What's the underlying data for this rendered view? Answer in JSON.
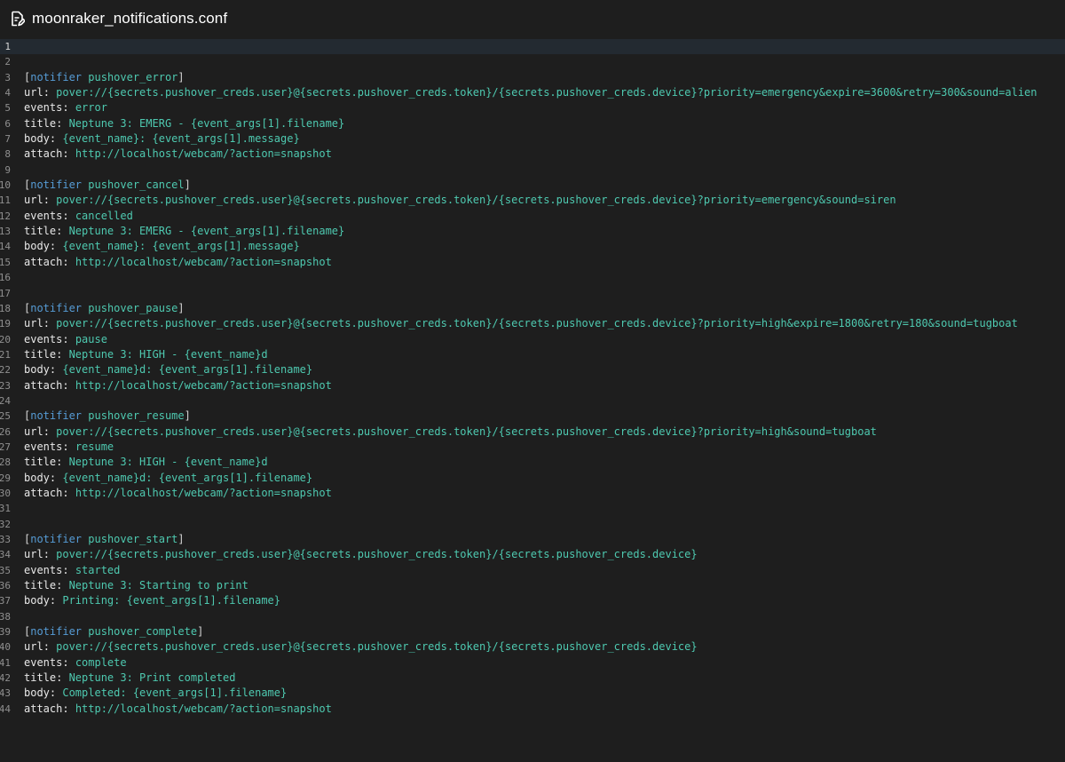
{
  "window": {
    "title": "moonraker_notifications.conf",
    "icon": "file-edit-icon"
  },
  "colors": {
    "background": "#1e1e1e",
    "keyword": "#569cd6",
    "section_name": "#4ec9b0",
    "value": "#4ec9b0",
    "key": "#e8e8e8",
    "line_number": "#8f8f8f"
  },
  "editor": {
    "active_line": 1,
    "lines": [
      {
        "n": "1",
        "kind": "blank"
      },
      {
        "n": "2",
        "kind": "blank"
      },
      {
        "n": "3",
        "kind": "section",
        "keyword": "notifier",
        "name": "pushover_error"
      },
      {
        "n": "4",
        "kind": "kv",
        "key": "url",
        "value": "pover://{secrets.pushover_creds.user}@{secrets.pushover_creds.token}/{secrets.pushover_creds.device}?priority=emergency&expire=3600&retry=300&sound=alien"
      },
      {
        "n": "5",
        "kind": "kv",
        "key": "events",
        "value": "error"
      },
      {
        "n": "6",
        "kind": "kv",
        "key": "title",
        "value": "Neptune 3: EMERG - {event_args[1].filename}"
      },
      {
        "n": "7",
        "kind": "kv",
        "key": "body",
        "value": "{event_name}: {event_args[1].message}"
      },
      {
        "n": "8",
        "kind": "kv",
        "key": "attach",
        "value": "http://localhost/webcam/?action=snapshot"
      },
      {
        "n": "9",
        "kind": "blank"
      },
      {
        "n": "10",
        "kind": "section",
        "keyword": "notifier",
        "name": "pushover_cancel"
      },
      {
        "n": "11",
        "kind": "kv",
        "key": "url",
        "value": "pover://{secrets.pushover_creds.user}@{secrets.pushover_creds.token}/{secrets.pushover_creds.device}?priority=emergency&sound=siren"
      },
      {
        "n": "12",
        "kind": "kv",
        "key": "events",
        "value": "cancelled"
      },
      {
        "n": "13",
        "kind": "kv",
        "key": "title",
        "value": "Neptune 3: EMERG - {event_args[1].filename}"
      },
      {
        "n": "14",
        "kind": "kv",
        "key": "body",
        "value": "{event_name}: {event_args[1].message}"
      },
      {
        "n": "15",
        "kind": "kv",
        "key": "attach",
        "value": "http://localhost/webcam/?action=snapshot"
      },
      {
        "n": "16",
        "kind": "blank"
      },
      {
        "n": "17",
        "kind": "blank"
      },
      {
        "n": "18",
        "kind": "section",
        "keyword": "notifier",
        "name": "pushover_pause"
      },
      {
        "n": "19",
        "kind": "kv",
        "key": "url",
        "value": "pover://{secrets.pushover_creds.user}@{secrets.pushover_creds.token}/{secrets.pushover_creds.device}?priority=high&expire=1800&retry=180&sound=tugboat"
      },
      {
        "n": "20",
        "kind": "kv",
        "key": "events",
        "value": "pause"
      },
      {
        "n": "21",
        "kind": "kv",
        "key": "title",
        "value": "Neptune 3: HIGH - {event_name}d"
      },
      {
        "n": "22",
        "kind": "kv",
        "key": "body",
        "value": "{event_name}d: {event_args[1].filename}"
      },
      {
        "n": "23",
        "kind": "kv",
        "key": "attach",
        "value": "http://localhost/webcam/?action=snapshot"
      },
      {
        "n": "24",
        "kind": "blank"
      },
      {
        "n": "25",
        "kind": "section",
        "keyword": "notifier",
        "name": "pushover_resume"
      },
      {
        "n": "26",
        "kind": "kv",
        "key": "url",
        "value": "pover://{secrets.pushover_creds.user}@{secrets.pushover_creds.token}/{secrets.pushover_creds.device}?priority=high&sound=tugboat"
      },
      {
        "n": "27",
        "kind": "kv",
        "key": "events",
        "value": "resume"
      },
      {
        "n": "28",
        "kind": "kv",
        "key": "title",
        "value": "Neptune 3: HIGH - {event_name}d"
      },
      {
        "n": "29",
        "kind": "kv",
        "key": "body",
        "value": "{event_name}d: {event_args[1].filename}"
      },
      {
        "n": "30",
        "kind": "kv",
        "key": "attach",
        "value": "http://localhost/webcam/?action=snapshot"
      },
      {
        "n": "31",
        "kind": "blank"
      },
      {
        "n": "32",
        "kind": "blank"
      },
      {
        "n": "33",
        "kind": "section",
        "keyword": "notifier",
        "name": "pushover_start"
      },
      {
        "n": "34",
        "kind": "kv",
        "key": "url",
        "value": "pover://{secrets.pushover_creds.user}@{secrets.pushover_creds.token}/{secrets.pushover_creds.device}"
      },
      {
        "n": "35",
        "kind": "kv",
        "key": "events",
        "value": "started"
      },
      {
        "n": "36",
        "kind": "kv",
        "key": "title",
        "value": "Neptune 3: Starting to print"
      },
      {
        "n": "37",
        "kind": "kv",
        "key": "body",
        "value": "Printing: {event_args[1].filename}"
      },
      {
        "n": "38",
        "kind": "blank"
      },
      {
        "n": "39",
        "kind": "section",
        "keyword": "notifier",
        "name": "pushover_complete"
      },
      {
        "n": "40",
        "kind": "kv",
        "key": "url",
        "value": "pover://{secrets.pushover_creds.user}@{secrets.pushover_creds.token}/{secrets.pushover_creds.device}"
      },
      {
        "n": "41",
        "kind": "kv",
        "key": "events",
        "value": "complete"
      },
      {
        "n": "42",
        "kind": "kv",
        "key": "title",
        "value": "Neptune 3: Print completed"
      },
      {
        "n": "43",
        "kind": "kv",
        "key": "body",
        "value": "Completed: {event_args[1].filename}"
      },
      {
        "n": "44",
        "kind": "kv",
        "key": "attach",
        "value": "http://localhost/webcam/?action=snapshot"
      }
    ]
  }
}
